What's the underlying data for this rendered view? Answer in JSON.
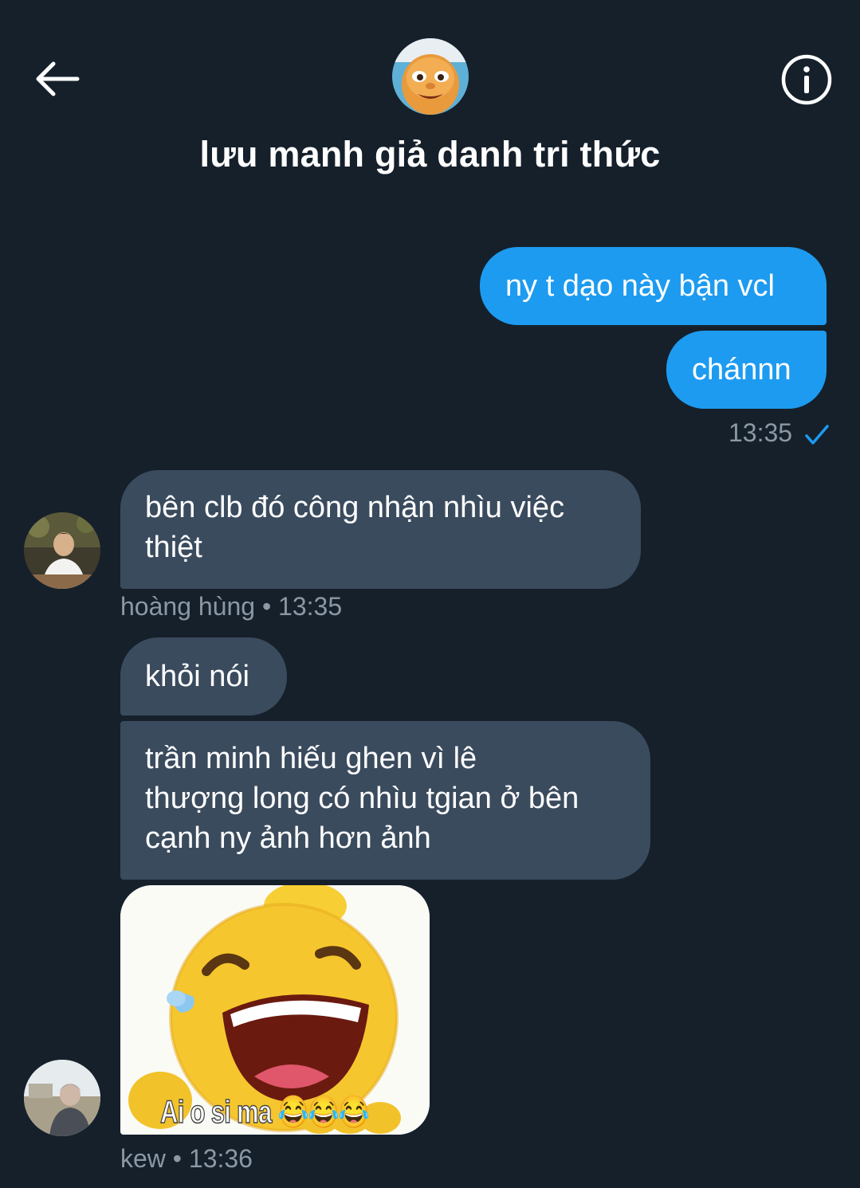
{
  "header": {
    "title": "lưu manh giả danh tri thức",
    "back_icon": "arrow-left-icon",
    "info_icon": "info-icon",
    "avatar_icon": "group-avatar"
  },
  "messages": {
    "outgoing": [
      {
        "text": "ny t dạo này bận vcl"
      },
      {
        "text": "chánnn"
      }
    ],
    "outgoing_meta": {
      "time": "13:35",
      "status_icon": "checkmark-icon"
    },
    "hoang_group": {
      "bubbles": [
        {
          "line1": "bên clb đó công nhận nhìu việc",
          "line2": "thiệt"
        }
      ],
      "meta": "hoàng hùng • 13:35"
    },
    "kew_group": {
      "bubbles": [
        {
          "line1": "khỏi nói"
        },
        {
          "line1": "trần minh hiếu ghen vì lê",
          "line2": "thượng long có nhìu tgian ở bên",
          "line3": "cạnh ny ảnh hơn ảnh"
        }
      ],
      "sticker_caption": "Ai o si ma 😂😂😂",
      "meta": "kew • 13:36"
    }
  },
  "colors": {
    "background": "#15202b",
    "outgoing_bubble": "#1d9bf0",
    "incoming_bubble": "#3b4b5e",
    "meta_text": "#8b98a5"
  }
}
